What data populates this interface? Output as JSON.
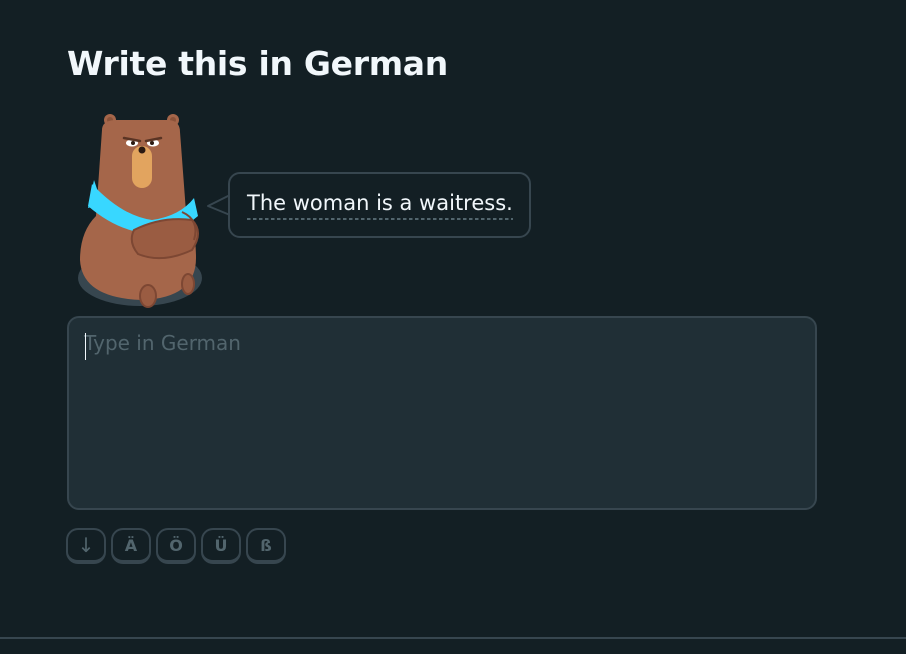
{
  "header": {
    "title": "Write this in German"
  },
  "prompt": {
    "sentence": "The woman is a waitress."
  },
  "answer": {
    "placeholder": "Type in German",
    "value": ""
  },
  "keyboard": {
    "keys": [
      {
        "label": "↓"
      },
      {
        "label": "Ä"
      },
      {
        "label": "Ö"
      },
      {
        "label": "Ü"
      },
      {
        "label": "ß"
      }
    ]
  },
  "colors": {
    "background": "#131f24",
    "input_background": "#202f36",
    "border": "#37464f",
    "text": "#f1f7fb",
    "muted": "#52656d",
    "scarf": "#38d7ff",
    "bear_fur": "#a5664a"
  }
}
